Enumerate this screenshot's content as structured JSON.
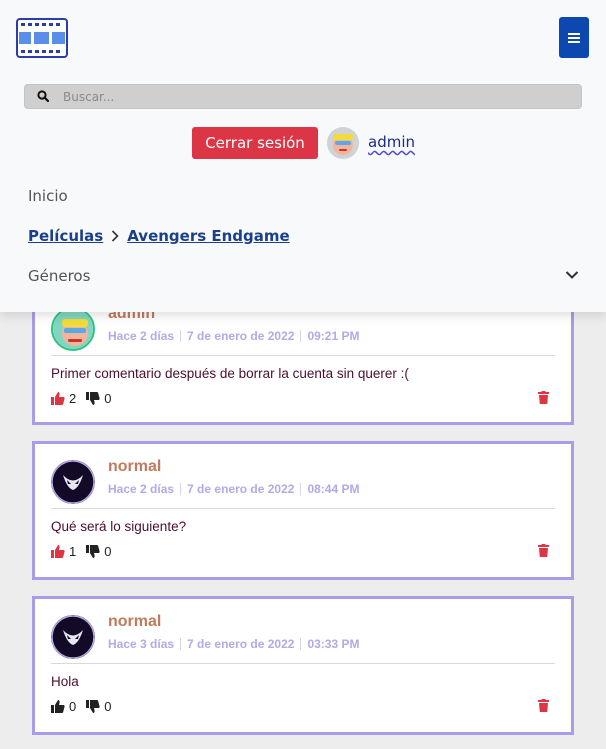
{
  "header": {
    "search_placeholder": "Buscar...",
    "logout_label": "Cerrar sesión",
    "username": "admin",
    "nav_home": "Inicio",
    "breadcrumb": [
      "Películas",
      "Avengers Endgame"
    ],
    "genres_label": "Géneros"
  },
  "comments": [
    {
      "user": "admin",
      "ago": "Hace 2 días",
      "date": "7 de enero de 2022",
      "time": "09:21 PM",
      "text": "Primer comentario después de borrar la cuenta sin querer :(",
      "likes": "2",
      "dislikes": "0",
      "liked": true
    },
    {
      "user": "normal",
      "ago": "Hace 2 días",
      "date": "7 de enero de 2022",
      "time": "08:44 PM",
      "text": "Qué será lo siguiente?",
      "likes": "1",
      "dislikes": "0",
      "liked": true
    },
    {
      "user": "normal",
      "ago": "Hace 3 días",
      "date": "7 de enero de 2022",
      "time": "03:33 PM",
      "text": "Hola",
      "likes": "0",
      "dislikes": "0",
      "liked": false
    }
  ],
  "colors": {
    "accent_blue": "#0d47b0",
    "danger": "#dc3545",
    "card_border": "#a99ce8",
    "username": "#c27a5c",
    "meta": "#b3a9e6"
  },
  "icons": [
    "film-logo-icon",
    "hamburger-icon",
    "search-icon",
    "chevron-right-icon",
    "chevron-down-icon",
    "thumbs-up-icon",
    "thumbs-down-icon",
    "trash-icon"
  ]
}
